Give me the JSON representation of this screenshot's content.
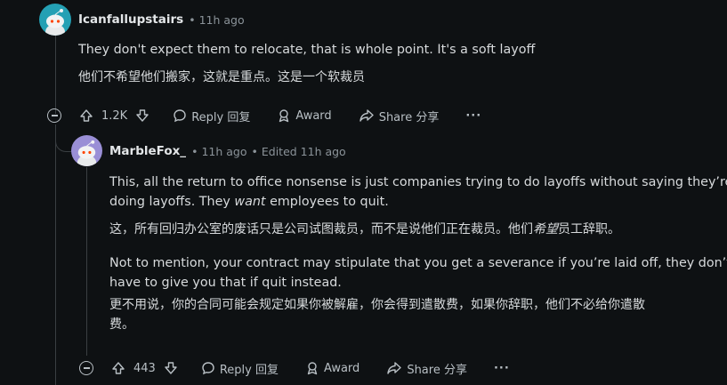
{
  "comment1": {
    "username": "Icanfallupstairs",
    "time": "11h ago",
    "text_en": "They don't expect them to relocate, that is whole point. It's a soft layoff",
    "text_zh": "他们不希望他们搬家，这就是重点。这是一个软裁员",
    "actions": {
      "votes": "1.2K",
      "reply": "Reply 回复",
      "award": "Award",
      "share": "Share 分享",
      "more": "···"
    }
  },
  "comment2": {
    "username": "MarbleFox_",
    "time": "11h ago",
    "edited": "Edited 11h ago",
    "p1_en_a": "This, all the return to office nonsense is just companies trying to do layoffs without saying they’re",
    "p1_en_b_pre": "doing layoffs. They ",
    "p1_en_b_em": "want",
    "p1_en_b_post": " employees to quit.",
    "p1_zh_pre": "这，所有回归办公室的废话只是公司试图裁员，而不是说他们正在裁员。他们",
    "p1_zh_em": "希望",
    "p1_zh_post": "员工辞职。",
    "p2_en_a": "Not to mention, your contract may stipulate that you get a severance if you’re laid off, they don’t",
    "p2_en_b": "have to give you that if quit instead.",
    "p2_zh_a": "更不用说，你的合同可能会规定如果你被解雇，你会得到遣散费，如果你辞职，他们不必给你遣散",
    "p2_zh_b": "费。",
    "actions": {
      "votes": "443",
      "reply": "Reply 回复",
      "award": "Award",
      "share": "Share 分享",
      "more": "···"
    }
  },
  "separator": "•",
  "colors": {
    "background": "#0e1113",
    "text": "#d7dadc",
    "meta": "#8b9399",
    "avatar1": "#24a0b4",
    "avatar2": "#9a8fd6"
  }
}
